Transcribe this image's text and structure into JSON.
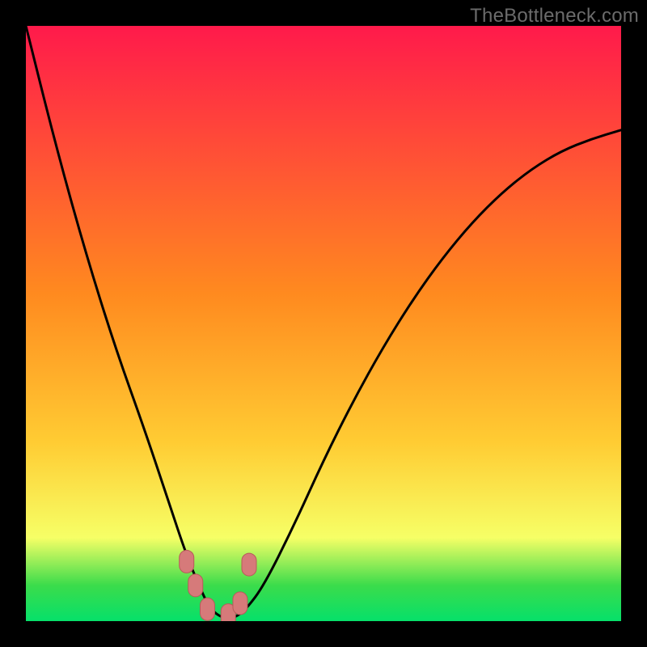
{
  "watermark": "TheBottleneck.com",
  "colors": {
    "frame": "#000000",
    "gradient_top": "#ff1a4b",
    "gradient_mid": "#ffcc33",
    "gradient_low": "#f6ff66",
    "gradient_green_mid": "#3bdc4b",
    "gradient_green_bottom": "#06e06a",
    "curve_stroke": "#000000",
    "marker_fill": "#d67a7a",
    "marker_stroke": "#b85a5a"
  },
  "chart_data": {
    "type": "line",
    "title": "",
    "xlabel": "",
    "ylabel": "",
    "xlim": [
      0,
      100
    ],
    "ylim": [
      0,
      100
    ],
    "series": [
      {
        "name": "bottleneck-curve",
        "x": [
          0,
          5,
          10,
          15,
          20,
          24,
          27,
          29.5,
          31,
          33,
          35,
          37,
          40,
          45,
          50,
          55,
          60,
          65,
          70,
          75,
          80,
          85,
          90,
          95,
          100
        ],
        "y": [
          100,
          80,
          62,
          46,
          32,
          20,
          11,
          5,
          2,
          0.5,
          0.5,
          2,
          6,
          16,
          27,
          37,
          46,
          54,
          61,
          67,
          72,
          76,
          79,
          81,
          82.5
        ]
      }
    ],
    "markers": [
      {
        "name": "left-shoulder-top",
        "x": 27.0,
        "y": 10.0
      },
      {
        "name": "left-shoulder-mid",
        "x": 28.5,
        "y": 6.0
      },
      {
        "name": "trough-left",
        "x": 30.5,
        "y": 2.0
      },
      {
        "name": "trough-right",
        "x": 34.0,
        "y": 1.0
      },
      {
        "name": "right-shoulder-mid",
        "x": 36.0,
        "y": 3.0
      },
      {
        "name": "right-shoulder-top",
        "x": 37.5,
        "y": 9.5
      }
    ]
  }
}
